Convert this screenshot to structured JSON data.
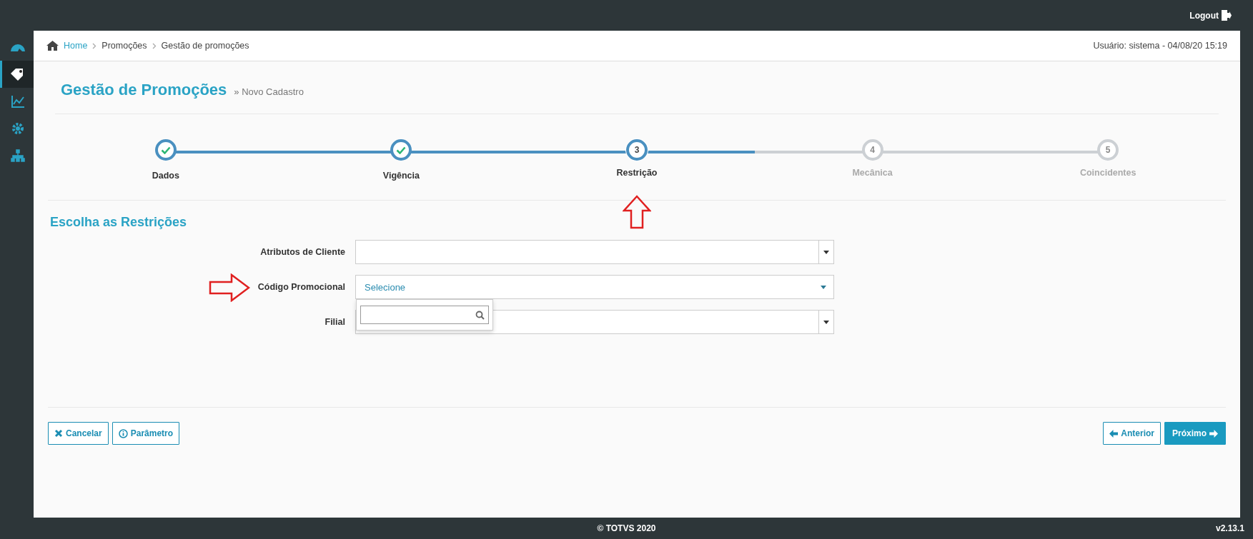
{
  "top_bar": {
    "logout": "Logout"
  },
  "sidebar": {
    "items": [
      {
        "selected": false
      },
      {
        "selected": true
      },
      {
        "selected": false
      },
      {
        "selected": false
      },
      {
        "selected": false
      }
    ]
  },
  "breadcrumb": {
    "items": [
      "Home",
      "Promoções",
      "Gestão de promoções"
    ],
    "user_info": "Usuário: sistema - 04/08/20 15:19"
  },
  "page": {
    "title": "Gestão de Promoções",
    "subtitle": "» Novo Cadastro"
  },
  "steps": [
    {
      "label": "Dados",
      "completed": true,
      "selected": false
    },
    {
      "label": "Vigência",
      "completed": true,
      "selected": false
    },
    {
      "number": "3",
      "label": "Restrição",
      "completed": false,
      "selected": true
    },
    {
      "number": "4",
      "label": "Mecânica",
      "completed": false,
      "selected": false
    },
    {
      "number": "5",
      "label": "Coincidentes",
      "completed": false,
      "selected": false
    }
  ],
  "section_title": "Escolha as Restrições",
  "fields": [
    {
      "label": "Atributos de Cliente",
      "kind": "combo",
      "open": false
    },
    {
      "label": "Código Promocional",
      "kind": "select",
      "placeholder": "Selecione",
      "open": true
    },
    {
      "label": "Filial",
      "kind": "combo",
      "open": false
    }
  ],
  "buttons_left": [
    {
      "label": "Cancelar",
      "kind": "cancel"
    },
    {
      "label": "Parâmetro",
      "kind": "info"
    }
  ],
  "buttons_right": [
    {
      "label": "Anterior",
      "kind": "prev"
    },
    {
      "label": "Próximo",
      "kind": "next"
    }
  ],
  "footer": {
    "copyright": "© TOTVS 2020",
    "version": "v2.13.1"
  }
}
